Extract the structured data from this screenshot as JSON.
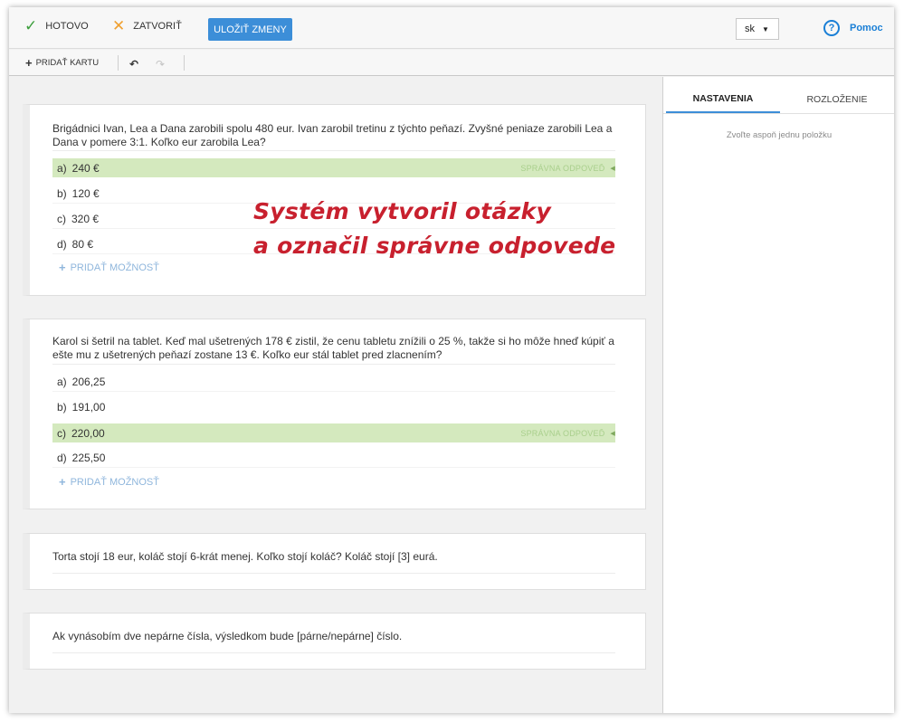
{
  "topbar": {
    "done_label": "HOTOVO",
    "close_label": "ZATVORIŤ",
    "save_label": "ULOŽIŤ ZMENY",
    "language": "sk",
    "help_label": "Pomoc",
    "help_icon_glyph": "?"
  },
  "toolbar": {
    "add_card_label": "PRIDAŤ KARTU"
  },
  "annotation": {
    "line1": "Systém vytvoril otázky",
    "line2": "a označil správne odpovede"
  },
  "correct_tag": "SPRÁVNA ODPOVEĎ",
  "add_option_label": "PRIDAŤ MOŽNOSŤ",
  "cards": [
    {
      "question": "Brigádnici Ivan, Lea a Dana zarobili spolu 480 eur. Ivan zarobil tretinu z týchto peňazí. Zvyšné peniaze zarobili Lea a Dana v pomere 3:1. Koľko eur zarobila Lea?",
      "answers": [
        {
          "letter": "a)",
          "text": "240 €",
          "correct": true
        },
        {
          "letter": "b)",
          "text": "120 €",
          "correct": false
        },
        {
          "letter": "c)",
          "text": "320 €",
          "correct": false
        },
        {
          "letter": "d)",
          "text": "80 €",
          "correct": false
        }
      ]
    },
    {
      "question": "Karol si šetril na tablet. Keď mal ušetrených 178 € zistil, že cenu tabletu znížili o 25 %, takže si ho môže hneď kúpiť a ešte mu z ušetrených peňazí zostane 13 €. Koľko eur stál tablet pred zlacnením?",
      "answers": [
        {
          "letter": "a)",
          "text": "206,25",
          "correct": false
        },
        {
          "letter": "b)",
          "text": "191,00",
          "correct": false
        },
        {
          "letter": "c)",
          "text": "220,00",
          "correct": true
        },
        {
          "letter": "d)",
          "text": "225,50",
          "correct": false
        }
      ]
    },
    {
      "question": "Torta stojí 18 eur, koláč stojí 6-krát menej. Koľko stojí koláč? Koláč stojí [3] eurá."
    },
    {
      "question": "Ak vynásobím dve nepárne čísla, výsledkom bude [párne/nepárne] číslo."
    }
  ],
  "panel": {
    "tab_settings": "NASTAVENIA",
    "tab_layout": "ROZLOŽENIE",
    "hint": "Zvoľte aspoň jednu položku"
  },
  "colors": {
    "accent": "#3c8ed8",
    "correct_bg": "#d4e9be",
    "annotation": "#c8202e"
  }
}
